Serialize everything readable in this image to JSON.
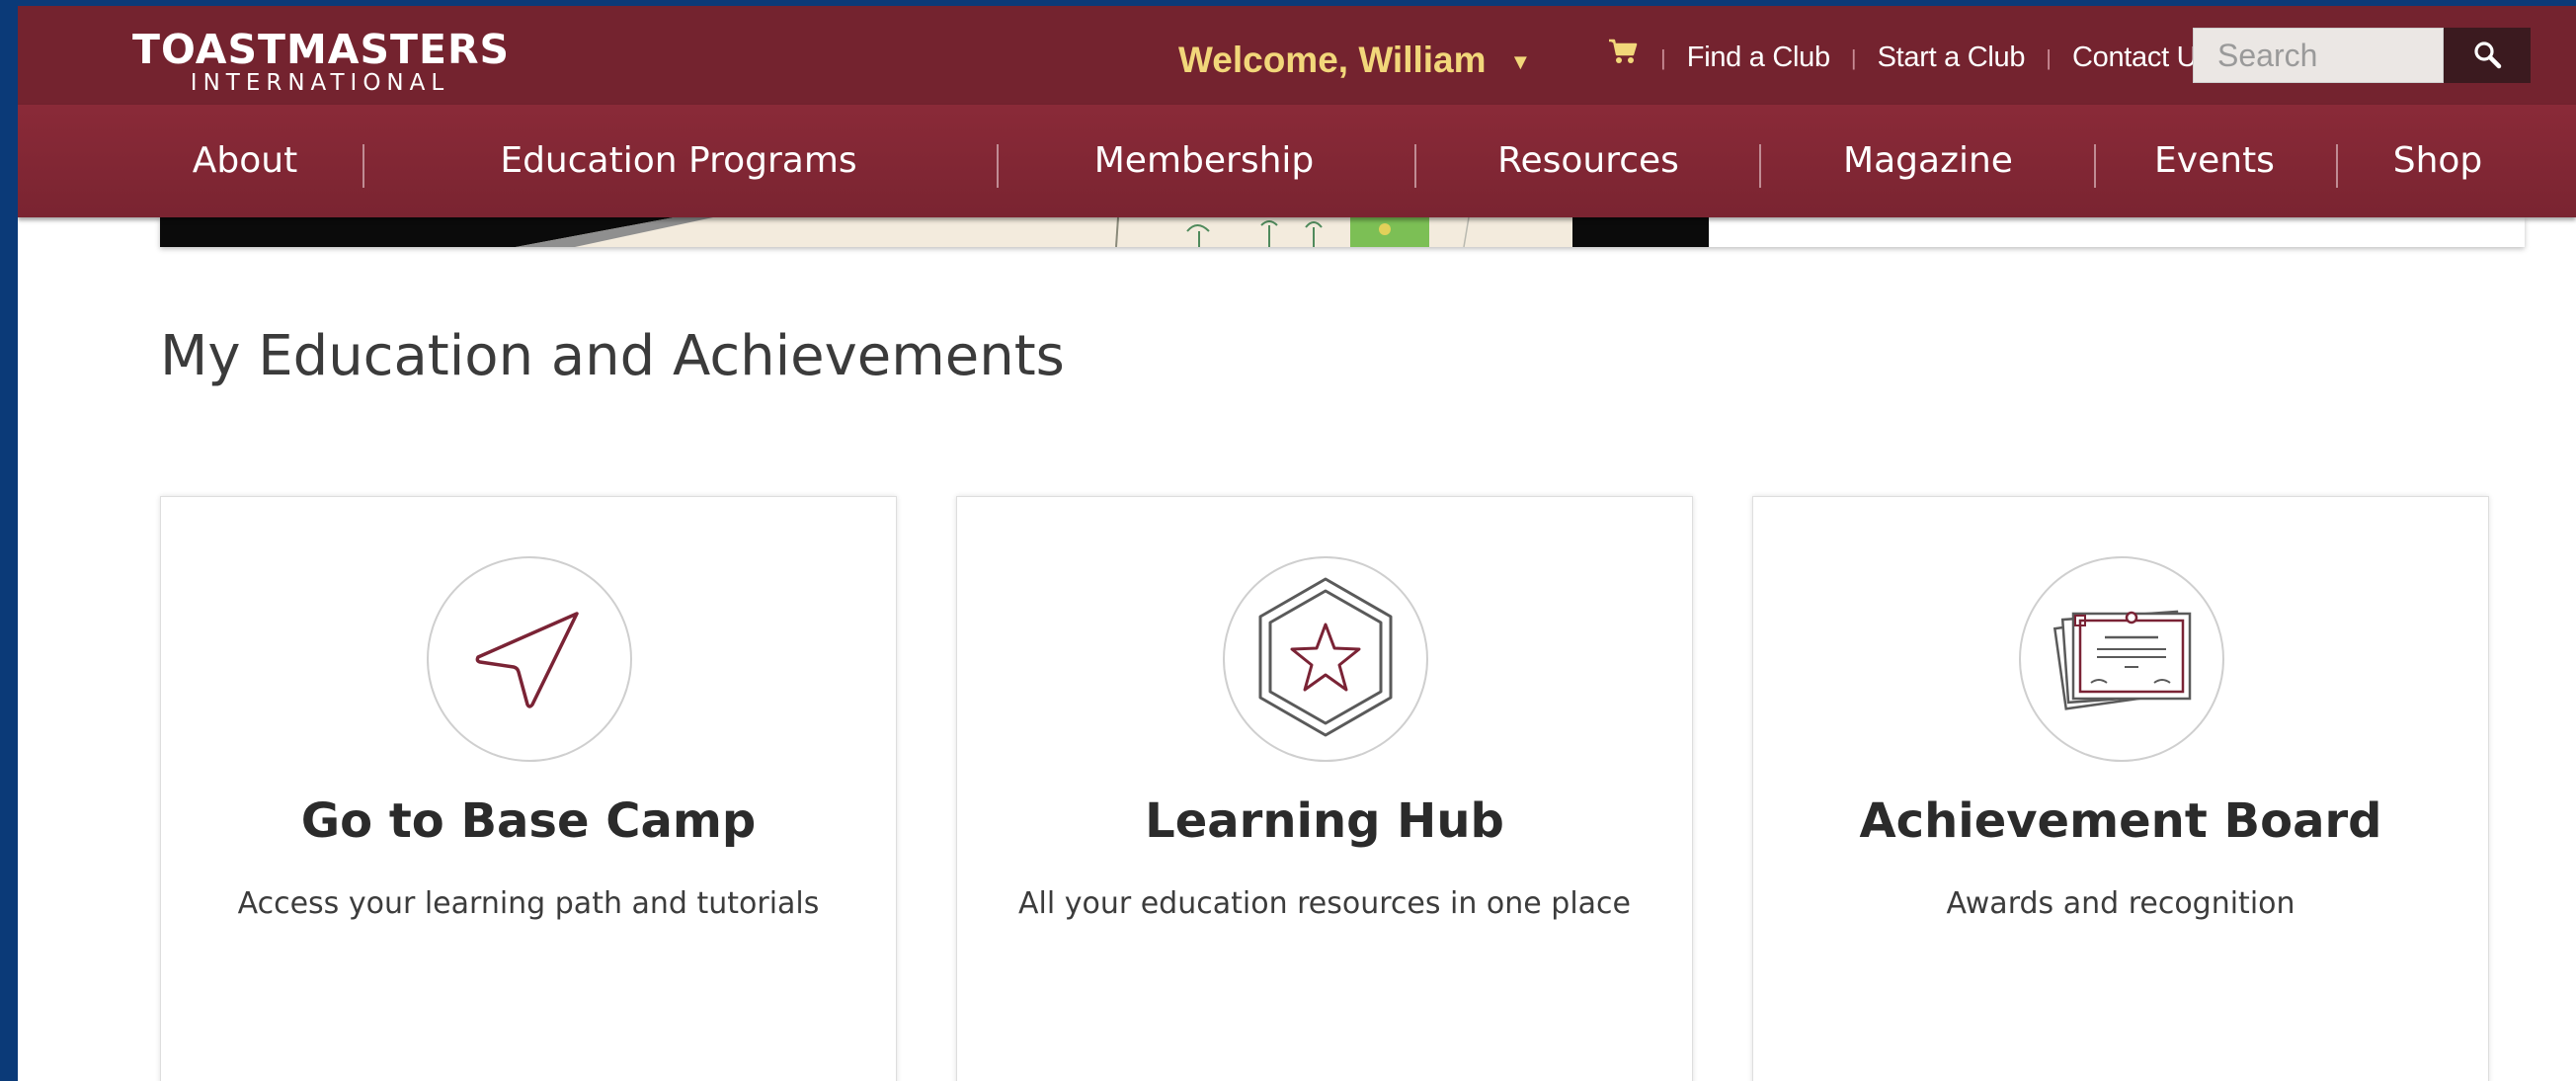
{
  "brand": {
    "logo_main": "TOASTMASTERS",
    "logo_sub": "INTERNATIONAL",
    "accent_color": "#74232f",
    "welcome_color": "#f2d77a"
  },
  "utility_bar": {
    "welcome_text": "Welcome, William",
    "welcome_caret": "▼",
    "cart_icon": "cart-icon",
    "links": [
      {
        "label": "Find a Club"
      },
      {
        "label": "Start a Club"
      },
      {
        "label": "Contact Us"
      }
    ],
    "search": {
      "placeholder": "Search",
      "value": "",
      "button_icon": "search-icon"
    }
  },
  "nav": {
    "items": [
      {
        "label": "About"
      },
      {
        "label": "Education Programs"
      },
      {
        "label": "Membership"
      },
      {
        "label": "Resources"
      },
      {
        "label": "Magazine"
      },
      {
        "label": "Events"
      },
      {
        "label": "Shop"
      }
    ]
  },
  "section": {
    "title": "My Education and Achievements",
    "cards": [
      {
        "title": "Go to Base Camp",
        "description": "Access your learning path and tutorials",
        "icon": "paper-plane-icon"
      },
      {
        "title": "Learning Hub",
        "description": "All your education resources in one place",
        "icon": "hexagon-star-icon"
      },
      {
        "title": "Achievement Board",
        "description": "Awards and recognition",
        "icon": "certificate-icon"
      }
    ]
  }
}
